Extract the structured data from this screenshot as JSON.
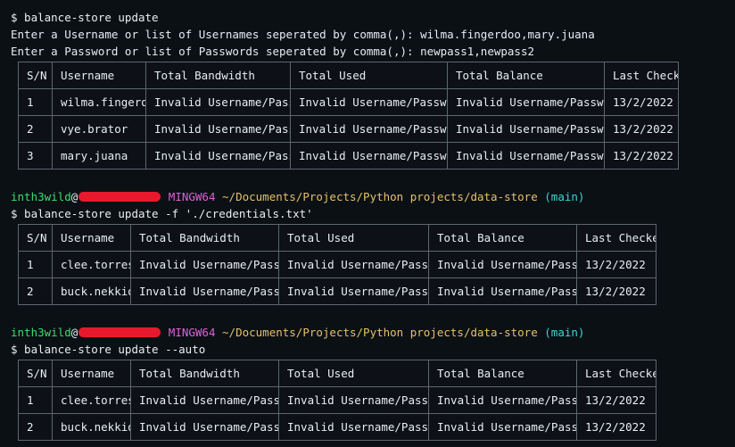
{
  "terminal": {
    "background": "#0b1014",
    "foreground": "#e6edf3",
    "accent_invalid": "#e5c04a",
    "accent_user": "#3ddc6e",
    "accent_host": "#e060d8",
    "accent_path": "#e5c06a",
    "accent_branch": "#3ad7d7",
    "redaction_color": "#e8192c"
  },
  "block1": {
    "command": "$ balance-store update",
    "prompt_username": "Enter a Username or list of Usernames seperated by comma(,): wilma.fingerdoo,mary.juana",
    "prompt_password": "Enter a Password or list of Passwords seperated by comma(,): newpass1,newpass2",
    "table": {
      "headers": [
        "S/N",
        "Username",
        "Total Bandwidth",
        "Total Used",
        "Total Balance",
        "Last Checked"
      ],
      "rows": [
        [
          "1",
          "wilma.fingerdoo",
          "Invalid Username/Password",
          "Invalid Username/Password",
          "Invalid Username/Password",
          "13/2/2022"
        ],
        [
          "2",
          "vye.brator",
          "Invalid Username/Password",
          "Invalid Username/Password",
          "Invalid Username/Password",
          "13/2/2022"
        ],
        [
          "3",
          "mary.juana",
          "Invalid Username/Password",
          "Invalid Username/Password",
          "Invalid Username/Password",
          "13/2/2022"
        ]
      ]
    }
  },
  "block2": {
    "prompt": {
      "user": "inth3wild",
      "redacted": true,
      "host": "MINGW64",
      "path": "~/Documents/Projects/Python projects/data-store",
      "branch": "(main)"
    },
    "command": "$ balance-store update -f './credentials.txt'",
    "table": {
      "headers": [
        "S/N",
        "Username",
        "Total Bandwidth",
        "Total Used",
        "Total Balance",
        "Last Checked"
      ],
      "rows": [
        [
          "1",
          "clee.torres",
          "Invalid Username/Password",
          "Invalid Username/Password",
          "Invalid Username/Password",
          "13/2/2022"
        ],
        [
          "2",
          "buck.nekkid",
          "Invalid Username/Password",
          "Invalid Username/Password",
          "Invalid Username/Password",
          "13/2/2022"
        ]
      ]
    }
  },
  "block3": {
    "prompt": {
      "user": "inth3wild",
      "redacted": true,
      "host": "MINGW64",
      "path": "~/Documents/Projects/Python projects/data-store",
      "branch": "(main)"
    },
    "command": "$ balance-store update --auto",
    "table": {
      "headers": [
        "S/N",
        "Username",
        "Total Bandwidth",
        "Total Used",
        "Total Balance",
        "Last Checked"
      ],
      "rows": [
        [
          "1",
          "clee.torres",
          "Invalid Username/Password",
          "Invalid Username/Password",
          "Invalid Username/Password",
          "13/2/2022"
        ],
        [
          "2",
          "buck.nekkid",
          "Invalid Username/Password",
          "Invalid Username/Password",
          "Invalid Username/Password",
          "13/2/2022"
        ]
      ]
    }
  }
}
